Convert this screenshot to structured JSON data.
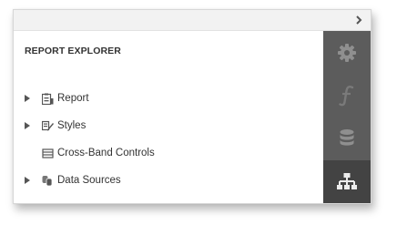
{
  "panel": {
    "title": "REPORT EXPLORER"
  },
  "tree": {
    "items": [
      {
        "label": "Report",
        "icon": "report-icon",
        "expandable": true
      },
      {
        "label": "Styles",
        "icon": "styles-icon",
        "expandable": true
      },
      {
        "label": "Cross-Band Controls",
        "icon": "cross-band-icon",
        "expandable": false
      },
      {
        "label": "Data Sources",
        "icon": "data-sources-icon",
        "expandable": true
      }
    ]
  },
  "toolbar": {
    "collapse_icon": "chevron-right-icon"
  },
  "sidebar": {
    "tabs": [
      {
        "name": "properties",
        "icon": "gear-icon",
        "active": false
      },
      {
        "name": "expressions",
        "icon": "function-icon",
        "active": false
      },
      {
        "name": "field-list",
        "icon": "database-icon",
        "active": false
      },
      {
        "name": "report-explorer",
        "icon": "hierarchy-icon",
        "active": true
      }
    ]
  },
  "colors": {
    "sidebar_bg": "#5c5c5c",
    "sidebar_active_bg": "#434343",
    "icon_light": "#e6e6e6",
    "icon_dim": "#7a7a7a",
    "text": "#333333"
  }
}
